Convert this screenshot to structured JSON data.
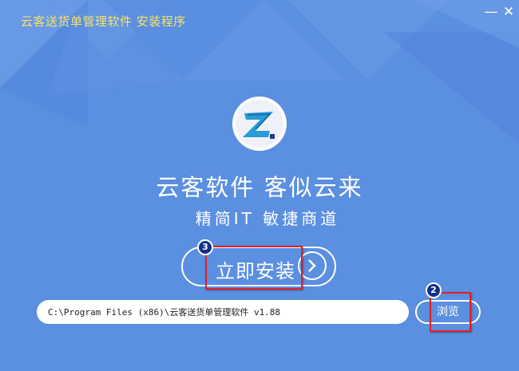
{
  "window": {
    "title": "云客送货单管理软件  安装程序",
    "minimize_label": "—",
    "close_label": "✕"
  },
  "logo": {
    "icon": "app-logo-icon"
  },
  "headline": "云客软件  客似云来",
  "slogan": "精简IT  敏捷商道",
  "install_button": {
    "label": "立即安装",
    "icon": "chevron-right-icon"
  },
  "install_path": {
    "value": "C:\\Program Files (x86)\\云客送货单管理软件 v1.88"
  },
  "browse_button": {
    "label": "浏览"
  },
  "annotations": {
    "markers": [
      {
        "number": "3",
        "target": "install_button"
      },
      {
        "number": "2",
        "target": "browse_button"
      }
    ],
    "box_color": "#e41e1e"
  },
  "colors": {
    "background": "#5b8fe0",
    "title_text": "#f5e36a",
    "text": "#ffffff"
  }
}
